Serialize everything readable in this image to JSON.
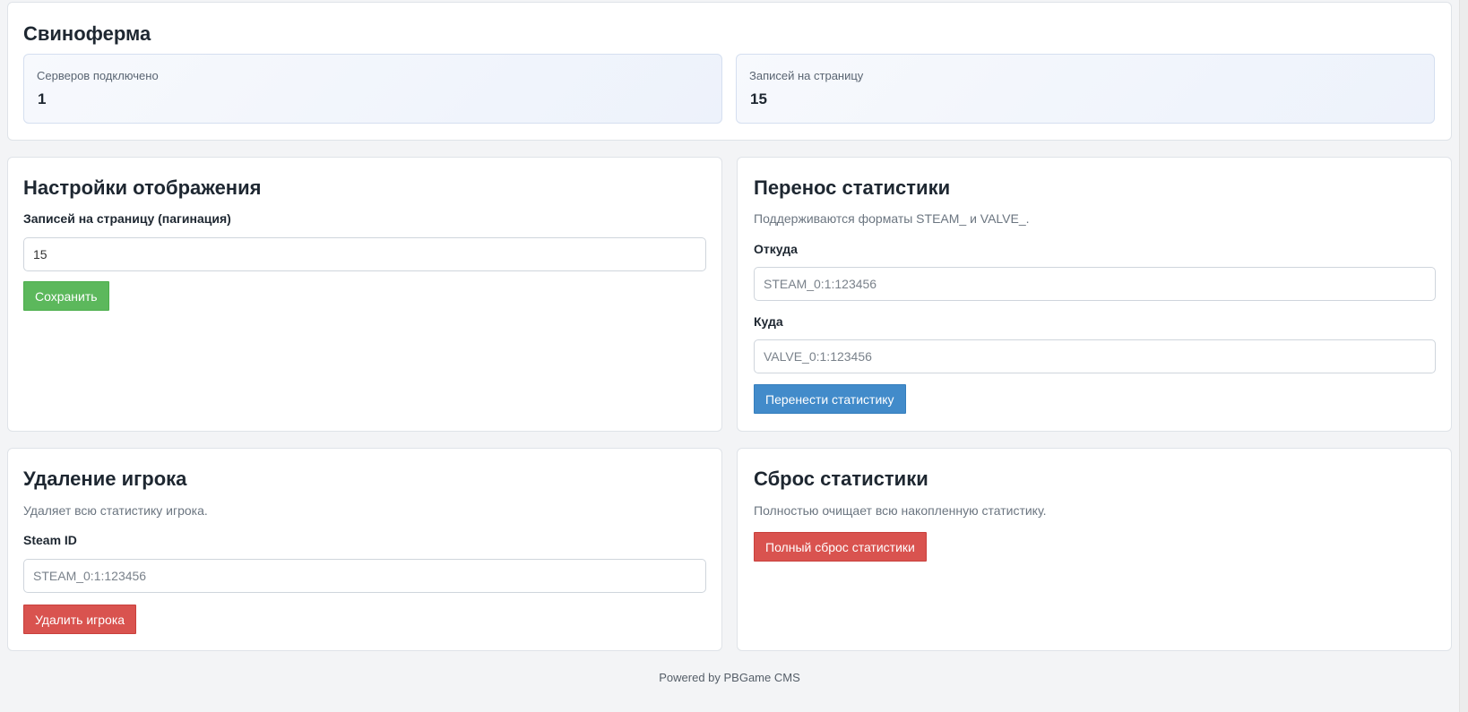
{
  "header": {
    "title": "Свиноферма",
    "stats": [
      {
        "label": "Серверов подключено",
        "value": "1"
      },
      {
        "label": "Записей на страницу",
        "value": "15"
      }
    ]
  },
  "display_settings": {
    "title": "Настройки отображения",
    "per_page_label": "Записей на страницу (пагинация)",
    "per_page_value": "15",
    "save_label": "Сохранить"
  },
  "transfer": {
    "title": "Перенос статистики",
    "description": "Поддерживаются форматы STEAM_ и VALVE_.",
    "from_label": "Откуда",
    "from_placeholder": "STEAM_0:1:123456",
    "to_label": "Куда",
    "to_placeholder": "VALVE_0:1:123456",
    "submit_label": "Перенести статистику"
  },
  "delete_player": {
    "title": "Удаление игрока",
    "description": "Удаляет всю статистику игрока.",
    "steam_label": "Steam ID",
    "steam_placeholder": "STEAM_0:1:123456",
    "submit_label": "Удалить игрока"
  },
  "reset_stats": {
    "title": "Сброс статистики",
    "description": "Полностью очищает всю накопленную статистику.",
    "submit_label": "Полный сброс статистики"
  },
  "footer": {
    "text": "Powered by PBGame CMS"
  },
  "colors": {
    "save": "#5cb85c",
    "transfer": "#428bca",
    "danger": "#d9534f"
  }
}
